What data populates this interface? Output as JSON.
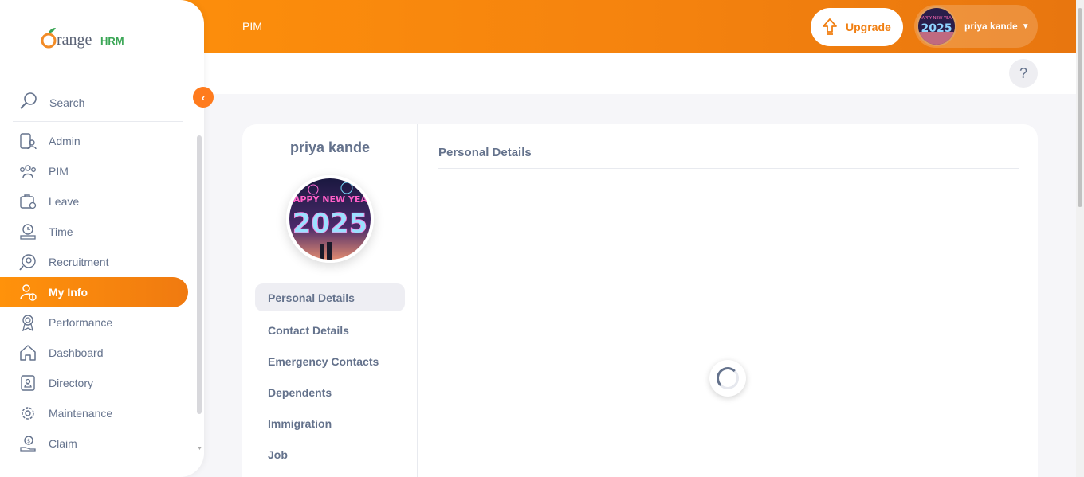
{
  "app": {
    "brand": "OrangeHRM",
    "brand_prefix": "range",
    "brand_suffix": "HRM"
  },
  "header": {
    "module_title": "PIM",
    "upgrade_label": "Upgrade",
    "user_name": "priya kande",
    "help_label": "?"
  },
  "sidebar": {
    "search_label": "Search",
    "items": [
      {
        "label": "Admin",
        "icon": "admin-icon"
      },
      {
        "label": "PIM",
        "icon": "pim-icon"
      },
      {
        "label": "Leave",
        "icon": "leave-icon"
      },
      {
        "label": "Time",
        "icon": "time-icon"
      },
      {
        "label": "Recruitment",
        "icon": "recruitment-icon"
      },
      {
        "label": "My Info",
        "icon": "my-info-icon",
        "active": true
      },
      {
        "label": "Performance",
        "icon": "performance-icon"
      },
      {
        "label": "Dashboard",
        "icon": "dashboard-icon"
      },
      {
        "label": "Directory",
        "icon": "directory-icon"
      },
      {
        "label": "Maintenance",
        "icon": "maintenance-icon"
      },
      {
        "label": "Claim",
        "icon": "claim-icon"
      }
    ]
  },
  "profile": {
    "name": "priya kande",
    "avatar_text_line1": "HAPPY NEW YEAR",
    "avatar_text_line2": "2025",
    "tabs": [
      {
        "label": "Personal Details",
        "active": true
      },
      {
        "label": "Contact Details"
      },
      {
        "label": "Emergency Contacts"
      },
      {
        "label": "Dependents"
      },
      {
        "label": "Immigration"
      },
      {
        "label": "Job"
      }
    ]
  },
  "main": {
    "section_title": "Personal Details"
  },
  "colors": {
    "accent": "#ff7b1d",
    "text": "#64728c",
    "brand_green": "#3aa655"
  }
}
